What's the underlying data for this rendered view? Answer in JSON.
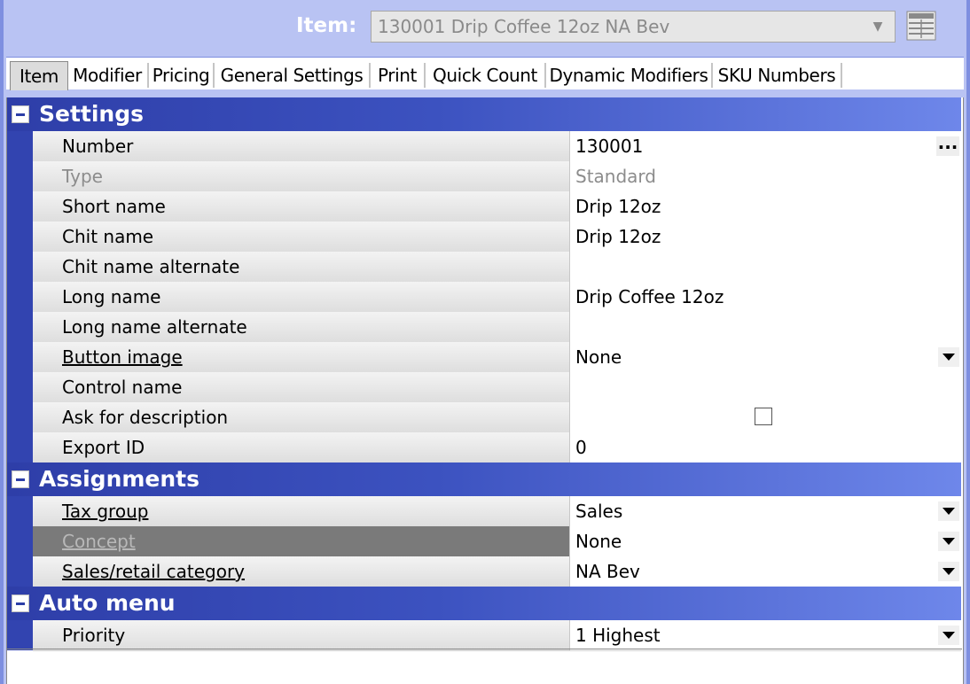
{
  "header": {
    "item_label": "Item:",
    "item_value": "130001 Drip Coffee 12oz NA Bev",
    "grid_icon": "grid-view-icon"
  },
  "tabs": [
    {
      "label": "Item",
      "active": true
    },
    {
      "label": "Modifier"
    },
    {
      "label": "Pricing"
    },
    {
      "label": "General Settings"
    },
    {
      "label": "Print"
    },
    {
      "label": "Quick Count"
    },
    {
      "label": "Dynamic Modifiers"
    },
    {
      "label": "SKU Numbers"
    }
  ],
  "sections": {
    "settings": {
      "title": "Settings",
      "rows": [
        {
          "name": "Number",
          "value": "130001",
          "control": "ellipsis"
        },
        {
          "name": "Type",
          "value": "Standard",
          "disabled": true
        },
        {
          "name": "Short name",
          "value": "Drip 12oz"
        },
        {
          "name": "Chit name",
          "value": "Drip 12oz"
        },
        {
          "name": "Chit name alternate",
          "value": ""
        },
        {
          "name": "Long name",
          "value": "Drip Coffee 12oz"
        },
        {
          "name": "Long name alternate",
          "value": ""
        },
        {
          "name": "Button image",
          "value": "None",
          "control": "dropdown",
          "link": true
        },
        {
          "name": "Control name",
          "value": ""
        },
        {
          "name": "Ask for description",
          "value": "",
          "control": "checkbox",
          "checked": false
        },
        {
          "name": "Export ID",
          "value": "0"
        }
      ]
    },
    "assignments": {
      "title": "Assignments",
      "rows": [
        {
          "name": "Tax group",
          "value": "Sales",
          "control": "dropdown",
          "link": true
        },
        {
          "name": "Concept",
          "value": "None",
          "control": "dropdown",
          "link": true,
          "selected": true
        },
        {
          "name": "Sales/retail category",
          "value": "NA Bev",
          "control": "dropdown",
          "link": true
        }
      ]
    },
    "auto_menu": {
      "title": "Auto menu",
      "rows": [
        {
          "name": "Priority",
          "value": "1 Highest",
          "control": "dropdown"
        }
      ]
    }
  },
  "colors": {
    "frame": "#b9c3f3",
    "section_dark": "#2e3ea8",
    "section_light": "#6e87ea",
    "selected_row": "#7a7a7a"
  }
}
